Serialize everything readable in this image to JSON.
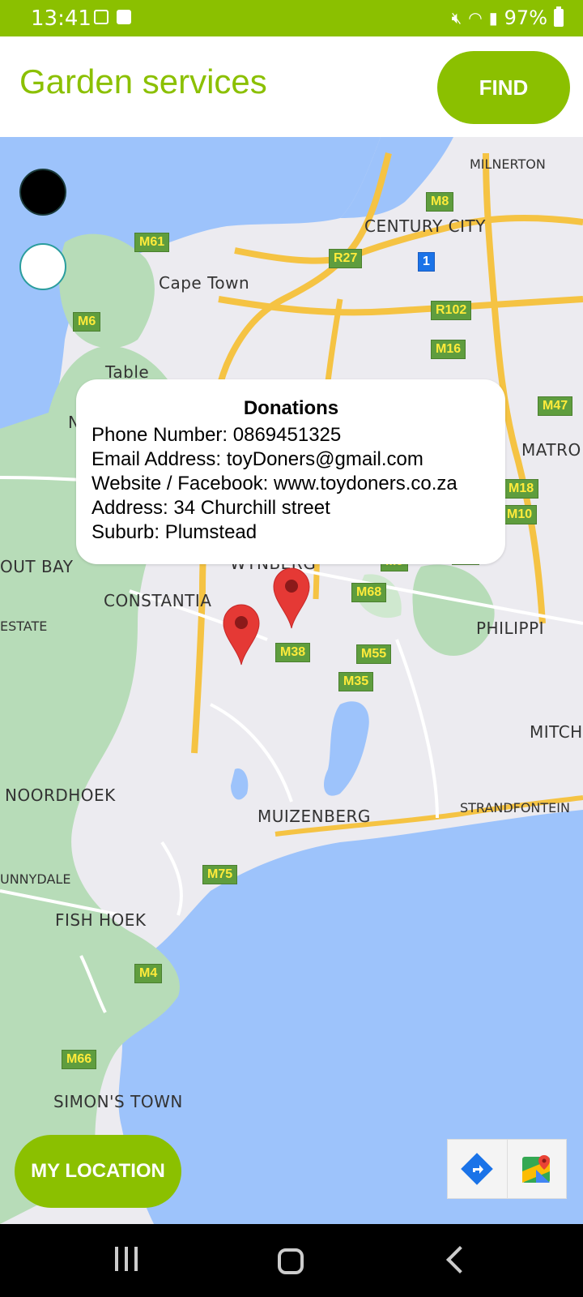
{
  "status_bar": {
    "time": "13:41",
    "battery": "97%"
  },
  "header": {
    "title": "Garden services",
    "find_label": "FIND"
  },
  "map": {
    "places": {
      "milnerton": "MILNERTON",
      "century_city": "CENTURY CITY",
      "cape_town": "Cape Town",
      "table": "Table",
      "n": "N",
      "out_bay": "OUT BAY",
      "wynberg": "WYNBERG",
      "constantia": "CONSTANTIA",
      "estate": "ESTATE",
      "philippi": "PHILIPPI",
      "matro": "MATRO",
      "mitch": "MITCH",
      "noordhoek": "NOORDHOEK",
      "muizenberg": "MUIZENBERG",
      "strandfontein": "STRANDFONTEIN",
      "sunnydale": "UNNYDALE",
      "fish_hoek": "FISH HOEK",
      "simons_town": "SIMON'S TOWN"
    },
    "roads": {
      "m61": "M61",
      "m8": "M8",
      "r27": "R27",
      "r1": "1",
      "m6": "M6",
      "r102": "R102",
      "m16": "M16",
      "m47": "M47",
      "m18": "M18",
      "m10": "M10",
      "m9": "M9",
      "m7": "M7",
      "m68": "M68",
      "m38": "M38",
      "m55": "M55",
      "m35": "M35",
      "m75": "M75",
      "m4": "M4",
      "m66": "M66"
    }
  },
  "info_window": {
    "title": "Donations",
    "phone": "Phone Number: 0869451325",
    "email": "Email Address: toyDoners@gmail.com",
    "website": "Website / Facebook: www.toydoners.co.za",
    "address": "Address: 34 Churchill street",
    "suburb": "Suburb: Plumstead"
  },
  "my_location_label": "MY LOCATION",
  "colors": {
    "accent": "#8bc000",
    "water": "#9dc3fb",
    "pin": "#e53935"
  }
}
